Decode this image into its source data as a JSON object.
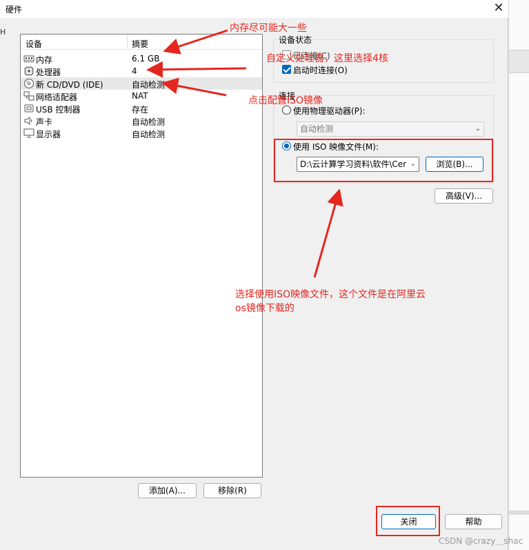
{
  "window": {
    "title": "硬件",
    "close_glyph": "✕"
  },
  "device_list": {
    "header_device": "设备",
    "header_summary": "摘要",
    "rows": [
      {
        "name": "内存",
        "summary": "6.1 GB",
        "icon": "memory-icon"
      },
      {
        "name": "处理器",
        "summary": "4",
        "icon": "processor-icon"
      },
      {
        "name": "新 CD/DVD (IDE)",
        "summary": "自动检测",
        "icon": "cd-dvd-icon"
      },
      {
        "name": "网络适配器",
        "summary": "NAT",
        "icon": "network-adapter-icon"
      },
      {
        "name": "USB 控制器",
        "summary": "存在",
        "icon": "usb-icon"
      },
      {
        "name": "声卡",
        "summary": "自动检测",
        "icon": "sound-card-icon"
      },
      {
        "name": "显示器",
        "summary": "自动检测",
        "icon": "display-icon"
      }
    ],
    "add_label": "添加(A)...",
    "remove_label": "移除(R)"
  },
  "device_status": {
    "title": "设备状态",
    "connected_label": "已连接(C)",
    "connect_at_power_on_label": "启动时连接(O)",
    "connect_at_power_on_checked": true
  },
  "connection": {
    "title": "连接",
    "physical_drive_label": "使用物理驱动器(P):",
    "physical_drive_value": "自动检测",
    "iso_label": "使用 ISO 映像文件(M):",
    "iso_path": "D:\\云计算学习资料\\软件\\Cer",
    "browse_label": "浏览(B)...",
    "advanced_label": "高级(V)..."
  },
  "footer": {
    "close_label": "关闭",
    "help_label": "帮助"
  },
  "annotations": {
    "memory_note": "内存尽可能大一些",
    "processor_note": "自定义处理器，这里选择4核",
    "iso_note": "点击配置ISO镜像",
    "iso_file_note_line1": "选择使用ISO映像文件，这个文件是在阿里云",
    "iso_file_note_line2": "os镜像下载的"
  },
  "watermark": "CSDN @crazy＿shac",
  "background_left_text": "H",
  "colors": {
    "accent": "#0067c0",
    "annotation_red": "#e5261f"
  }
}
